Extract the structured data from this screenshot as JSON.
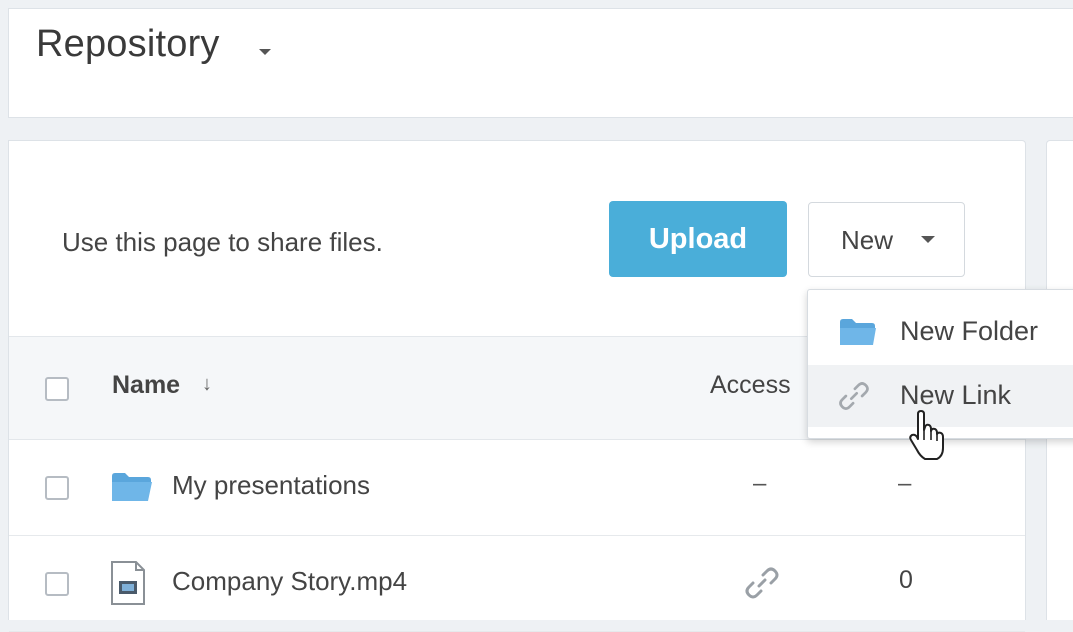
{
  "header": {
    "title": "Repository"
  },
  "toolbar": {
    "intro_text": "Use this page to share files.",
    "upload_label": "Upload",
    "new_label": "New"
  },
  "table": {
    "columns": {
      "name": "Name",
      "sort_indicator": "↓",
      "access": "Access"
    },
    "rows": [
      {
        "name": "My presentations",
        "icon": "folder-icon",
        "access": "–",
        "count": "–"
      },
      {
        "name": "Company Story.mp4",
        "icon": "video-file-icon",
        "access_icon": "link-icon",
        "count": "0"
      }
    ]
  },
  "new_menu": {
    "items": [
      {
        "label": "New Folder",
        "icon": "folder-icon"
      },
      {
        "label": "New Link",
        "icon": "link-icon"
      }
    ]
  },
  "colors": {
    "accent": "#4aaed9",
    "folder": "#6fb6e8",
    "background": "#eef1f4"
  }
}
